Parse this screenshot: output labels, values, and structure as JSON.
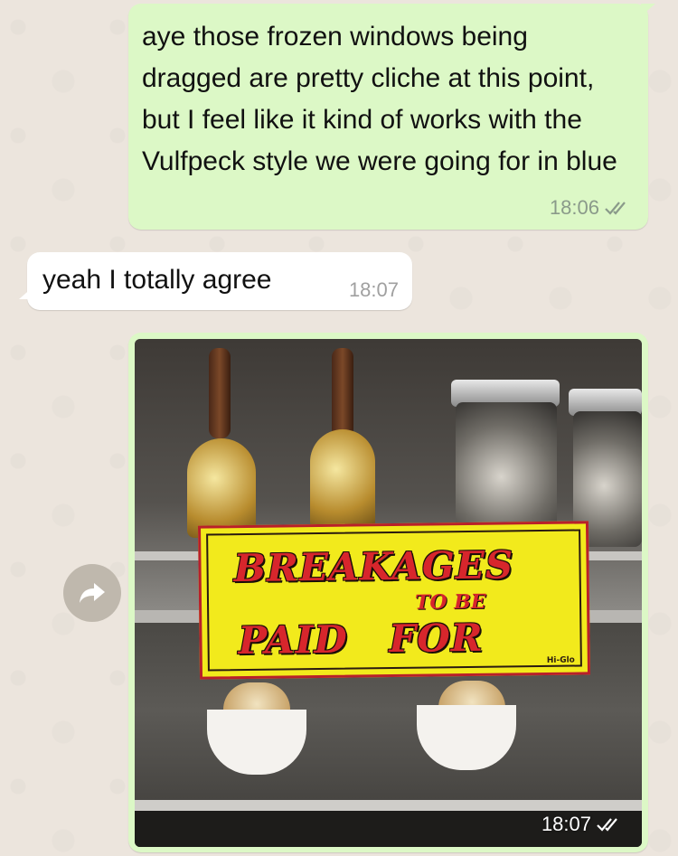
{
  "messages": [
    {
      "direction": "outgoing",
      "text": "aye those frozen windows being dragged are pretty cliche at this point, but I feel like it kind of works with the Vulfpeck style we were going for in blue",
      "time": "18:06",
      "status": "read"
    },
    {
      "direction": "incoming",
      "text": "yeah I totally agree",
      "time": "18:07"
    },
    {
      "direction": "outgoing",
      "type": "image",
      "image": {
        "sign_line1": "BREAKAGES",
        "sign_line2": "TO BE",
        "sign_line3": "PAID FOR",
        "sign_brand": "Hi-Glo"
      },
      "time": "18:07",
      "status": "read"
    }
  ],
  "icons": {
    "forward": "forward-arrow-icon",
    "read_receipt": "double-check-icon"
  },
  "colors": {
    "background": "#ece5dd",
    "outgoing_bubble": "#dcf8c6",
    "incoming_bubble": "#ffffff",
    "tick": "#8a9a8a",
    "forward_button": "#bfb8ad"
  }
}
